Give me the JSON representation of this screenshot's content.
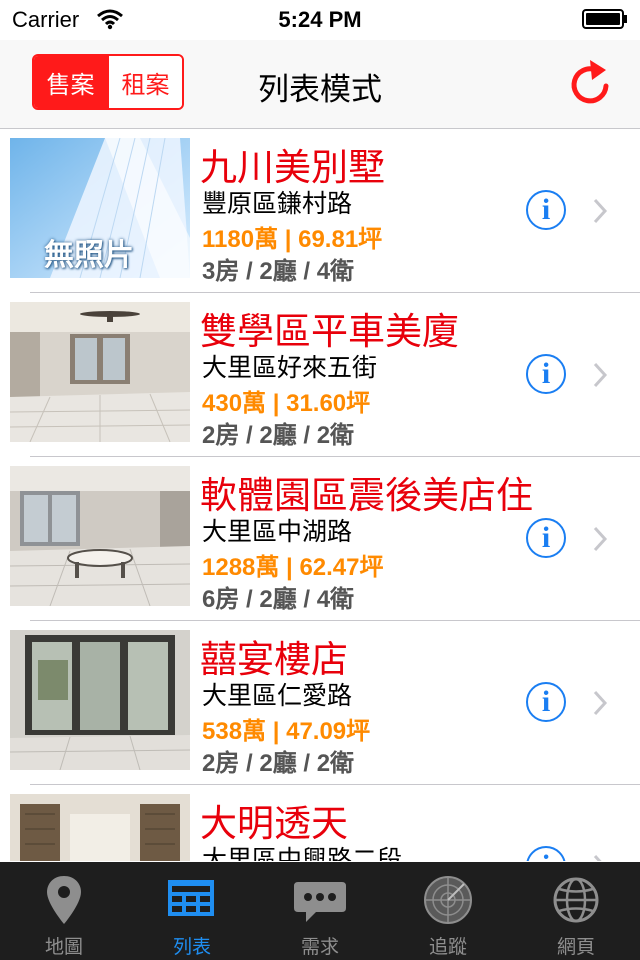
{
  "status_bar": {
    "carrier": "Carrier",
    "time": "5:24 PM"
  },
  "nav": {
    "segments": [
      {
        "label": "售案",
        "selected": true
      },
      {
        "label": "租案",
        "selected": false
      }
    ],
    "title": "列表模式",
    "accent_color": "#ff1a1a"
  },
  "listings": [
    {
      "title": "九川美別墅",
      "address": "豐原區鎌村路",
      "price": "1180萬 | 69.81坪",
      "rooms": "3房 / 2廳 / 4衛",
      "photo": "no-photo-placeholder",
      "photo_text": "無照片"
    },
    {
      "title": "雙學區平車美廈",
      "address": "大里區好來五街",
      "price": "430萬 | 31.60坪",
      "rooms": "2房 / 2廳 / 2衛",
      "photo": "living-room-ceiling-fan"
    },
    {
      "title": "軟體園區震後美店住",
      "address": "大里區中湖路",
      "price": "1288萬 | 62.47坪",
      "rooms": "6房 / 2廳 / 4衛",
      "photo": "living-room-table"
    },
    {
      "title": "囍宴樓店",
      "address": "大里區仁愛路",
      "price": "538萬 | 47.09坪",
      "rooms": "2房 / 2廳 / 2衛",
      "photo": "balcony-glass-doors"
    },
    {
      "title": "大明透天",
      "address": "大里區中興路二段",
      "price": "",
      "rooms": "",
      "photo": "doorway"
    }
  ],
  "tabs": [
    {
      "label": "地圖",
      "icon": "map-pin-icon",
      "selected": false
    },
    {
      "label": "列表",
      "icon": "list-icon",
      "selected": true
    },
    {
      "label": "需求",
      "icon": "chat-bubble-icon",
      "selected": false
    },
    {
      "label": "追蹤",
      "icon": "radar-icon",
      "selected": false
    },
    {
      "label": "網頁",
      "icon": "globe-icon",
      "selected": false
    }
  ],
  "colors": {
    "title_red": "#e8000b",
    "price_orange": "#ff8a00",
    "info_blue": "#1a7ef2",
    "tab_selected": "#1f8ef1"
  }
}
